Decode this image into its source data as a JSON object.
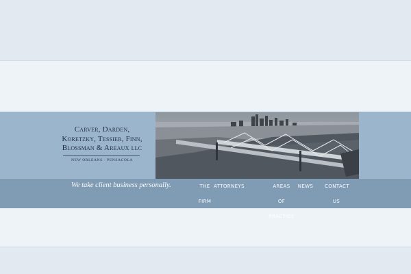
{
  "logo": {
    "line1": "Carver, Darden,",
    "line2": "Koretzky, Tessier, Finn,",
    "line3": "Blossman & Areaux llc",
    "cities": "NEW ORLEANS · PENSACOLA"
  },
  "photo": {
    "icon": "city-bridge-photo"
  },
  "tagline": "We take client business personally.",
  "nav": {
    "the_firm_1": "THE",
    "the_firm_2": "FIRM",
    "attorneys": "ATTORNEYS",
    "areas_1": "AREAS OF",
    "areas_2": "PRACTICE",
    "news": "NEWS",
    "contact_1": "CONTACT",
    "contact_2": "US"
  },
  "colors": {
    "page_bg": "#e2e9f1",
    "header_band": "#9bb5cc",
    "nav_band": "#7f9cb4",
    "logo_text": "#1f2f44"
  }
}
